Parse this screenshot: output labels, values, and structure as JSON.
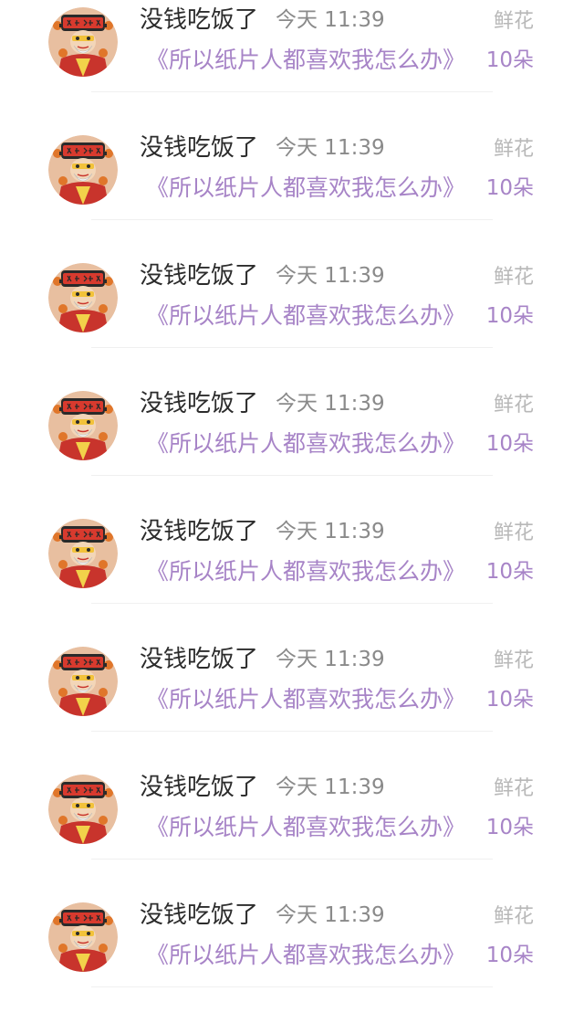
{
  "colors": {
    "accent_purple": "#a784c7",
    "name_text": "#2c2c2c",
    "time_text": "#8a8a8a",
    "gift_label": "#b8b8b8",
    "avatar_bg": "#e8bfa0"
  },
  "avatar_icon": "god-of-wealth-avatar-icon",
  "records": [
    {
      "user": "没钱吃饭了",
      "time": "今天 11:39",
      "book": "《所以纸片人都喜欢我怎么办》",
      "gift": "鲜花",
      "count": "10朵"
    },
    {
      "user": "没钱吃饭了",
      "time": "今天 11:39",
      "book": "《所以纸片人都喜欢我怎么办》",
      "gift": "鲜花",
      "count": "10朵"
    },
    {
      "user": "没钱吃饭了",
      "time": "今天 11:39",
      "book": "《所以纸片人都喜欢我怎么办》",
      "gift": "鲜花",
      "count": "10朵"
    },
    {
      "user": "没钱吃饭了",
      "time": "今天 11:39",
      "book": "《所以纸片人都喜欢我怎么办》",
      "gift": "鲜花",
      "count": "10朵"
    },
    {
      "user": "没钱吃饭了",
      "time": "今天 11:39",
      "book": "《所以纸片人都喜欢我怎么办》",
      "gift": "鲜花",
      "count": "10朵"
    },
    {
      "user": "没钱吃饭了",
      "time": "今天 11:39",
      "book": "《所以纸片人都喜欢我怎么办》",
      "gift": "鲜花",
      "count": "10朵"
    },
    {
      "user": "没钱吃饭了",
      "time": "今天 11:39",
      "book": "《所以纸片人都喜欢我怎么办》",
      "gift": "鲜花",
      "count": "10朵"
    },
    {
      "user": "没钱吃饭了",
      "time": "今天 11:39",
      "book": "《所以纸片人都喜欢我怎么办》",
      "gift": "鲜花",
      "count": "10朵"
    }
  ]
}
